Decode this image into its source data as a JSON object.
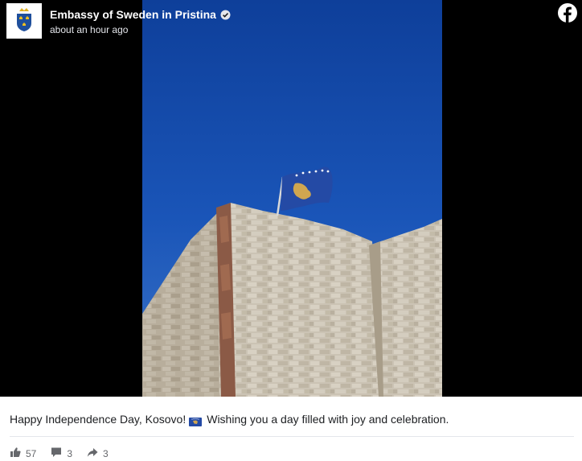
{
  "header": {
    "page_name": "Embassy of Sweden in Pristina",
    "timestamp": "about an hour ago"
  },
  "post": {
    "caption_before": "Happy Independence Day, Kosovo!",
    "caption_after": "Wishing you a day filled with joy and celebration."
  },
  "actions": {
    "likes": "57",
    "comments": "3",
    "shares": "3"
  },
  "icons": {
    "avatar": "sweden-coat-of-arms-icon",
    "verified": "verified-badge-icon",
    "brand": "facebook-logo-icon",
    "emoji": "kosovo-flag-icon",
    "like": "thumbs-up-icon",
    "comment": "comment-icon",
    "share": "share-icon"
  },
  "colors": {
    "sky": "#1a55b8",
    "kosovo_blue": "#244aa5",
    "kosovo_gold": "#d0a650",
    "stone": "#c9c1b2",
    "text_muted": "#65676b"
  }
}
